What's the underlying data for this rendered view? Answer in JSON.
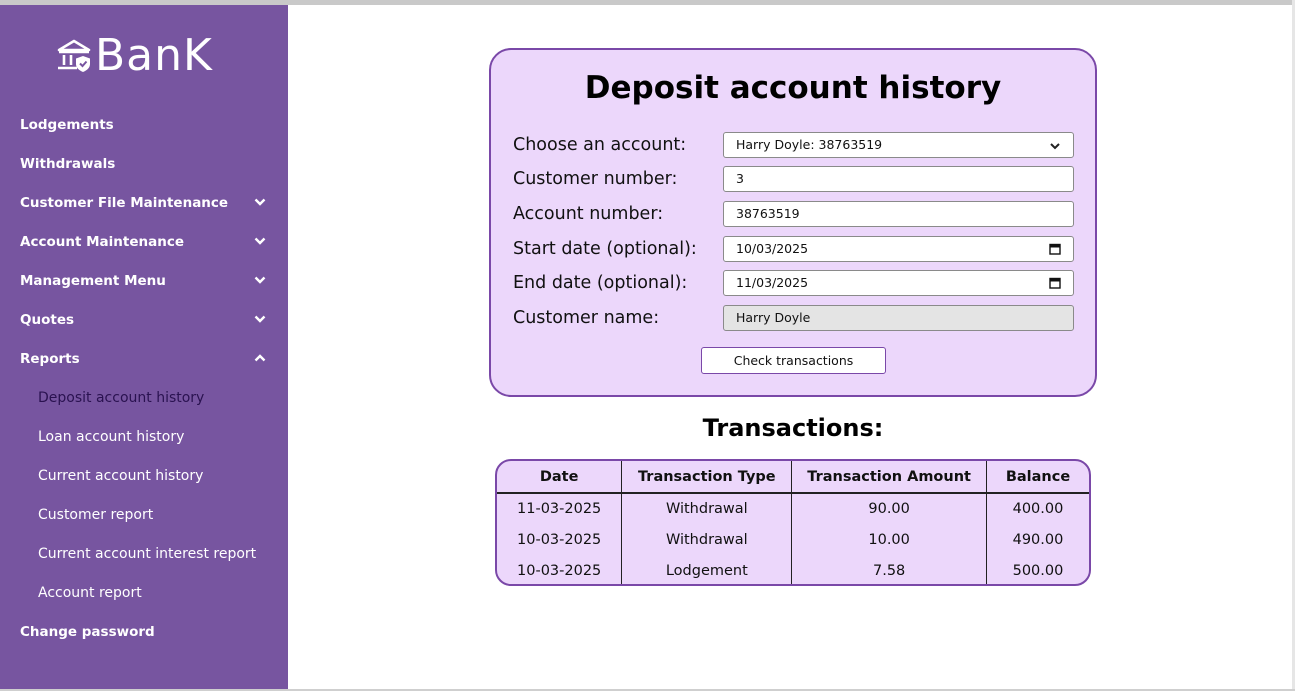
{
  "brand": {
    "name": "BanK",
    "icon": "bank-shield-icon"
  },
  "sidebar": {
    "items": [
      {
        "label": "Lodgements",
        "expandable": false
      },
      {
        "label": "Withdrawals",
        "expandable": false
      },
      {
        "label": "Customer File Maintenance",
        "expandable": true,
        "expanded": false
      },
      {
        "label": "Account Maintenance",
        "expandable": true,
        "expanded": false
      },
      {
        "label": "Management Menu",
        "expandable": true,
        "expanded": false
      },
      {
        "label": "Quotes",
        "expandable": true,
        "expanded": false
      },
      {
        "label": "Reports",
        "expandable": true,
        "expanded": true
      }
    ],
    "reports_sub": [
      {
        "label": "Deposit account history",
        "active": true
      },
      {
        "label": "Loan account history",
        "active": false
      },
      {
        "label": "Current account history",
        "active": false
      },
      {
        "label": "Customer report",
        "active": false
      },
      {
        "label": "Current account interest report",
        "active": false
      },
      {
        "label": "Account report",
        "active": false
      }
    ],
    "change_password": "Change password"
  },
  "form": {
    "title": "Deposit account history",
    "account": {
      "label": "Choose an account:",
      "value": "Harry Doyle: 38763519"
    },
    "customer_number": {
      "label": "Customer number:",
      "value": "3"
    },
    "account_number": {
      "label": "Account number:",
      "value": "38763519"
    },
    "start_date": {
      "label": "Start date (optional):",
      "value": "10/03/2025"
    },
    "end_date": {
      "label": "End date (optional):",
      "value": "11/03/2025"
    },
    "customer_name": {
      "label": "Customer name:",
      "value": "Harry Doyle"
    },
    "submit_label": "Check transactions"
  },
  "transactions": {
    "title": "Transactions:",
    "columns": [
      "Date",
      "Transaction Type",
      "Transaction Amount",
      "Balance"
    ],
    "rows": [
      [
        "11-03-2025",
        "Withdrawal",
        "90.00",
        "400.00"
      ],
      [
        "10-03-2025",
        "Withdrawal",
        "10.00",
        "490.00"
      ],
      [
        "10-03-2025",
        "Lodgement",
        "7.58",
        "500.00"
      ]
    ]
  },
  "colors": {
    "sidebar_bg": "#7755a0",
    "card_bg": "#ecd7fb",
    "card_border": "#7a48a8",
    "active_text": "#2a1250"
  }
}
